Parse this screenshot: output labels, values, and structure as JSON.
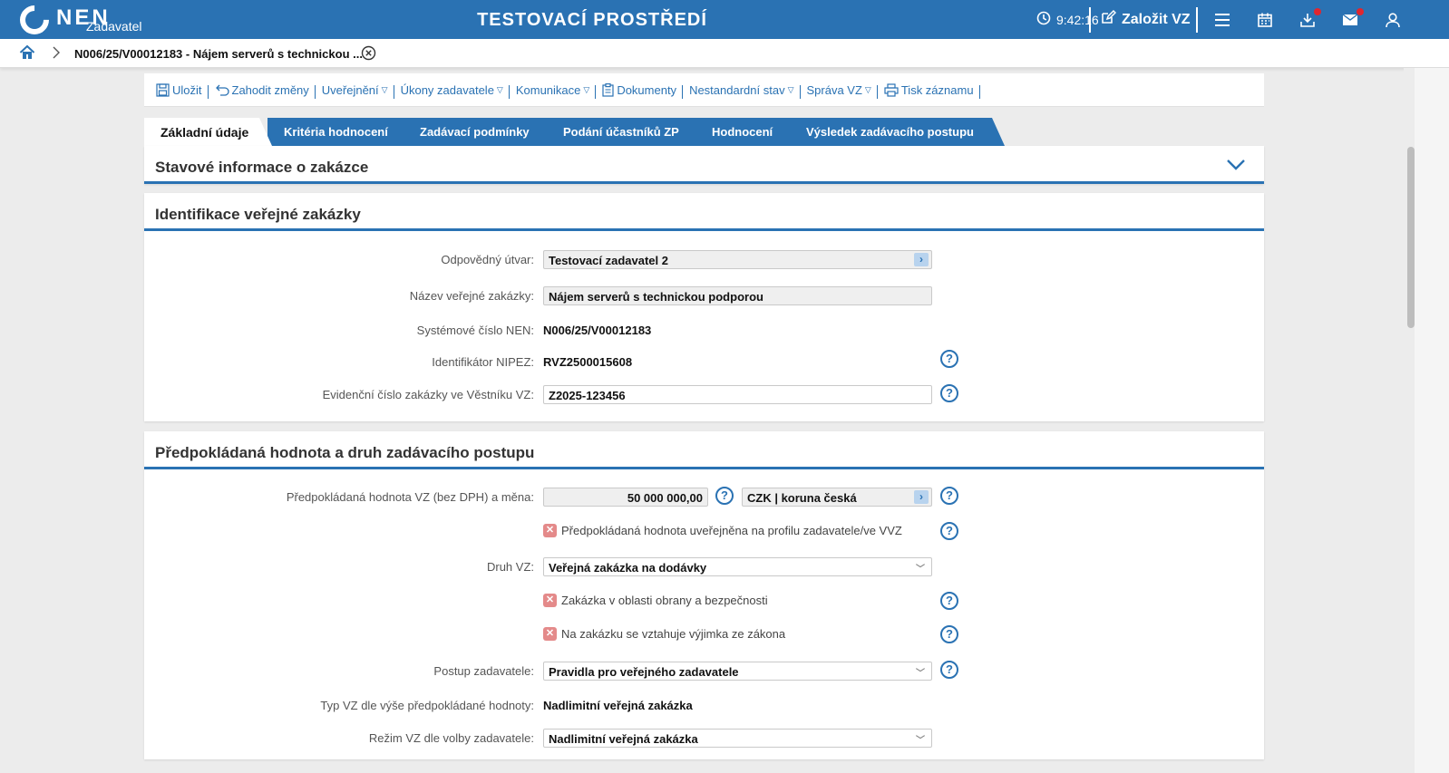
{
  "header": {
    "logo_text": "NEN",
    "logo_subtitle": "Zadavatel",
    "env_title": "TESTOVACÍ PROSTŘEDÍ",
    "time": "9:42:16",
    "create_label": "Založit VZ"
  },
  "breadcrumb": {
    "text": "N006/25/V00012183 - Nájem serverů s technickou ..."
  },
  "toolbar": {
    "items": [
      {
        "label": "Uložit",
        "icon": "save-icon"
      },
      {
        "label": "Zahodit změny",
        "icon": "undo-icon"
      },
      {
        "label": "Uveřejnění",
        "caret": true
      },
      {
        "label": "Úkony zadavatele",
        "caret": true
      },
      {
        "label": "Komunikace",
        "caret": true
      },
      {
        "label": "Dokumenty",
        "icon": "document-icon"
      },
      {
        "label": "Nestandardní stav",
        "caret": true
      },
      {
        "label": "Správa VZ",
        "caret": true
      },
      {
        "label": "Tisk záznamu",
        "icon": "print-icon"
      }
    ]
  },
  "tabs": [
    {
      "label": "Základní údaje",
      "active": true
    },
    {
      "label": "Kritéria hodnocení"
    },
    {
      "label": "Zadávací podmínky"
    },
    {
      "label": "Podání účastníků ZP"
    },
    {
      "label": "Hodnocení"
    },
    {
      "label": "Výsledek zadávacího postupu"
    }
  ],
  "status_panel": {
    "title": "Stavové informace o zakázce"
  },
  "identification": {
    "title": "Identifikace veřejné zakázky",
    "responsible_unit": {
      "label": "Odpovědný útvar:",
      "value": "Testovací zadavatel 2"
    },
    "contract_name": {
      "label": "Název veřejné zakázky:",
      "value": "Nájem serverů s technickou podporou"
    },
    "system_number": {
      "label": "Systémové číslo NEN:",
      "value": "N006/25/V00012183"
    },
    "nipez_id": {
      "label": "Identifikátor NIPEZ:",
      "value": "RVZ2500015608"
    },
    "bulletin_number": {
      "label": "Evidenční číslo zakázky ve Věstníku VZ:",
      "value": "Z2025-123456"
    }
  },
  "estimated": {
    "title": "Předpokládaná hodnota a druh zadávacího postupu",
    "value": {
      "label": "Předpokládaná hodnota VZ (bez DPH) a měna:",
      "amount": "50 000 000,00",
      "currency": "CZK | koruna česká"
    },
    "published_checkbox": "Předpokládaná hodnota uveřejněna na profilu zadavatele/ve VVZ",
    "type": {
      "label": "Druh VZ:",
      "value": "Veřejná zakázka na dodávky"
    },
    "defense_checkbox": "Zakázka v oblasti obrany a bezpečnosti",
    "exception_checkbox": "Na zakázku se vztahuje výjimka ze zákona",
    "procedure": {
      "label": "Postup zadavatele:",
      "value": "Pravidla pro veřejného zadavatele"
    },
    "type_by_value": {
      "label": "Typ VZ dle výše předpokládané hodnoty:",
      "value": "Nadlimitní veřejná zakázka"
    },
    "regime": {
      "label": "Režim VZ dle volby zadavatele:",
      "value": "Nadlimitní veřejná zakázka"
    }
  },
  "colors": {
    "brand": "#2a72b3",
    "notification": "#e0262f",
    "unchecked": "#e48a8a"
  }
}
